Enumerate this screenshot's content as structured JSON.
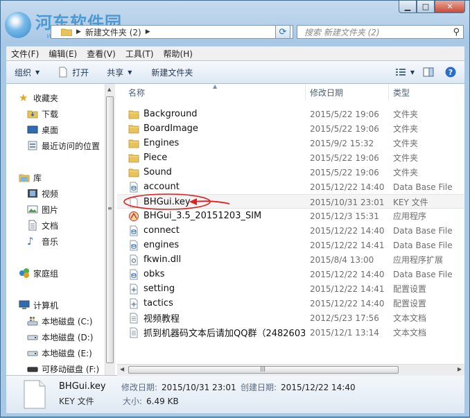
{
  "watermark": {
    "name": "河东软件园",
    "site": "www.pc0359.cn"
  },
  "address": {
    "path": "新建文件夹 (2)"
  },
  "search": {
    "placeholder": "搜索 新建文件夹 (2)"
  },
  "menu": [
    "文件(F)",
    "编辑(E)",
    "查看(V)",
    "工具(T)",
    "帮助(H)"
  ],
  "toolbar": {
    "organize": "组织",
    "open": "打开",
    "share": "共享",
    "new_folder": "新建文件夹"
  },
  "nav": {
    "favorites": "收藏夹",
    "favorites_items": [
      "下载",
      "桌面",
      "最近访问的位置"
    ],
    "libraries": "库",
    "libraries_items": [
      "视频",
      "图片",
      "文档",
      "音乐"
    ],
    "homegroup": "家庭组",
    "computer": "计算机",
    "computer_items": [
      "本地磁盘 (C:)",
      "本地磁盘 (D:)",
      "本地磁盘 (E:)",
      "可移动磁盘 (F:)"
    ]
  },
  "columns": {
    "name": "名称",
    "date": "修改日期",
    "type": "类型"
  },
  "files": [
    {
      "name": "Background",
      "date": "2015/5/22 19:06",
      "type": "文件夹",
      "icon": "folder-icon"
    },
    {
      "name": "BoardImage",
      "date": "2015/5/22 19:06",
      "type": "文件夹",
      "icon": "folder-icon"
    },
    {
      "name": "Engines",
      "date": "2015/9/2 15:32",
      "type": "文件夹",
      "icon": "folder-icon"
    },
    {
      "name": "Piece",
      "date": "2015/5/22 19:06",
      "type": "文件夹",
      "icon": "folder-icon"
    },
    {
      "name": "Sound",
      "date": "2015/5/22 19:06",
      "type": "文件夹",
      "icon": "folder-icon"
    },
    {
      "name": "account",
      "date": "2015/12/22 14:40",
      "type": "Data Base File",
      "icon": "database-file-icon"
    },
    {
      "name": "BHGui.key",
      "date": "2015/10/31 23:01",
      "type": "KEY 文件",
      "icon": "blank-file-icon"
    },
    {
      "name": "BHGui_3.5_20151203_SIM",
      "date": "2015/12/3 15:31",
      "type": "应用程序",
      "icon": "application-icon"
    },
    {
      "name": "connect",
      "date": "2015/12/22 14:40",
      "type": "Data Base File",
      "icon": "database-file-icon"
    },
    {
      "name": "engines",
      "date": "2015/12/22 14:41",
      "type": "Data Base File",
      "icon": "database-file-icon"
    },
    {
      "name": "fkwin.dll",
      "date": "2015/8/4 13:00",
      "type": "应用程序扩展",
      "icon": "dll-file-icon"
    },
    {
      "name": "obks",
      "date": "2015/12/22 14:40",
      "type": "Data Base File",
      "icon": "database-file-icon"
    },
    {
      "name": "setting",
      "date": "2015/12/22 14:41",
      "type": "配置设置",
      "icon": "config-file-icon"
    },
    {
      "name": "tactics",
      "date": "2015/12/22 14:40",
      "type": "配置设置",
      "icon": "config-file-icon"
    },
    {
      "name": "视频教程",
      "date": "2012/5/23 17:56",
      "type": "文本文档",
      "icon": "text-file-icon"
    },
    {
      "name": "抓到机器码文本后请加QQ群（2482603...",
      "date": "2015/12/1 13:14",
      "type": "文本文档",
      "icon": "text-file-icon"
    }
  ],
  "details": {
    "name": "BHGui.key",
    "type": "KEY 文件",
    "modified_label": "修改日期:",
    "modified": "2015/10/31 23:01",
    "created_label": "创建日期:",
    "created": "2015/12/22 14:40",
    "size_label": "大小:",
    "size": "6.49 KB"
  }
}
